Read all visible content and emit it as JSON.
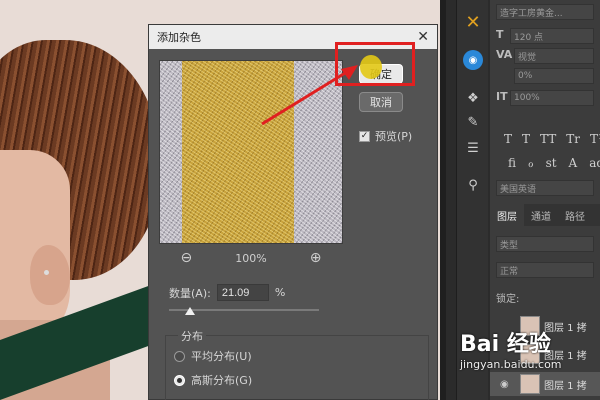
{
  "dialog": {
    "title": "添加杂色",
    "ok_label": "确定",
    "cancel_label": "取消",
    "preview_label": "预览(P)",
    "preview_checked": true,
    "zoom_level": "100%",
    "zoom_out_icon": "zoom-out-icon",
    "zoom_in_icon": "zoom-in-icon",
    "amount_label": "数量(A):",
    "amount_value": "21.09",
    "amount_unit": "%",
    "distribution": {
      "group_label": "分布",
      "uniform_label": "平均分布(U)",
      "gaussian_label": "高斯分布(G)",
      "selected": "gaussian"
    }
  },
  "character_panel": {
    "font_name": "造字工房黄金...",
    "font_size": "120 点",
    "kerning": "视觉",
    "tracking": "0%",
    "scale": "100%",
    "language": "美国英语",
    "typo_buttons_row1": [
      "T",
      "T",
      "TT",
      "Tr",
      "T¹",
      "T,"
    ],
    "typo_buttons_row2": [
      "ﬁ",
      "ℴ",
      "st",
      "A",
      "ad",
      "T"
    ]
  },
  "layers_panel": {
    "tabs": [
      "图层",
      "通道",
      "路径"
    ],
    "active_tab": "图层",
    "filter_kind": "类型",
    "blend_mode": "正常",
    "lock_label": "锁定:",
    "layers": [
      "图层 1 拷",
      "图层 1 拷",
      "图层 1 拷"
    ]
  },
  "watermark": {
    "logo": "Bai 经验",
    "url": "jingyan.baidu.com"
  },
  "colors": {
    "highlight": "#e02020",
    "arrow": "#e02020"
  }
}
